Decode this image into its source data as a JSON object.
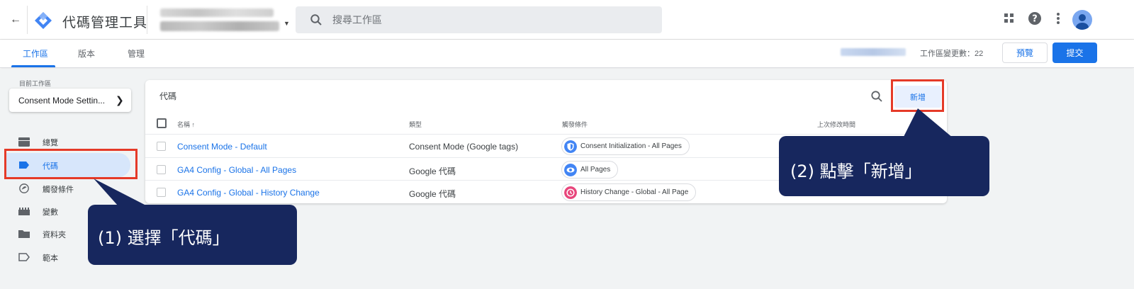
{
  "header": {
    "back_icon": "arrow-left-icon",
    "logo_icon": "gtm-diamond-logo",
    "app_title": "代碼管理工具",
    "account_selector_icon": "caret-down-icon",
    "search": {
      "placeholder": "搜尋工作區",
      "icon": "search-icon"
    },
    "icons": [
      "apps-grid-icon",
      "help-icon",
      "more-vert-icon",
      "account-avatar-icon"
    ]
  },
  "subnav": {
    "tabs": [
      {
        "label": "工作區",
        "active": true
      },
      {
        "label": "版本",
        "active": false
      },
      {
        "label": "管理",
        "active": false
      }
    ],
    "workspace_changes": "工作區變更數：22",
    "preview_label": "預覽",
    "submit_label": "提交"
  },
  "sidebar": {
    "current_workspace_label": "目前工作區",
    "workspace_name": "Consent Mode Settin...",
    "items": [
      {
        "label": "總覽",
        "icon": "overview-folder-icon",
        "active": false
      },
      {
        "label": "代碼",
        "icon": "tag-icon",
        "active": true
      },
      {
        "label": "觸發條件",
        "icon": "trigger-icon",
        "active": false
      },
      {
        "label": "變數",
        "icon": "variables-icon",
        "active": false
      },
      {
        "label": "資料夾",
        "icon": "folder-icon",
        "active": false
      },
      {
        "label": "範本",
        "icon": "template-icon",
        "active": false
      }
    ]
  },
  "tags_card": {
    "title": "代碼",
    "new_button": "新增",
    "columns": [
      "名稱 ↑",
      "類型",
      "觸發條件",
      "上次修改時間"
    ],
    "rows": [
      {
        "name": "Consent Mode - Default",
        "type": "Consent Mode (Google tags)",
        "trigger": "Consent Initialization - All Pages",
        "trigger_icon": "consent-shield-icon",
        "trigger_color": "#4285f4"
      },
      {
        "name": "GA4 Config - Global - All Pages",
        "type": "Google 代碼",
        "trigger": "All Pages",
        "trigger_icon": "eye-icon",
        "trigger_color": "#4285f4"
      },
      {
        "name": "GA4 Config - Global - History Change",
        "type": "Google 代碼",
        "trigger": "History Change - Global - All Page",
        "trigger_icon": "history-icon",
        "trigger_color": "#e8467c"
      }
    ]
  },
  "annotations": {
    "callout1": "(1) 選擇「代碼」",
    "callout2": "(2) 點擊「新增」",
    "highlight_color": "#e53a28",
    "callout_color": "#17275e"
  },
  "colors": {
    "accent": "#1a73e8",
    "background": "#f1f3f4"
  }
}
